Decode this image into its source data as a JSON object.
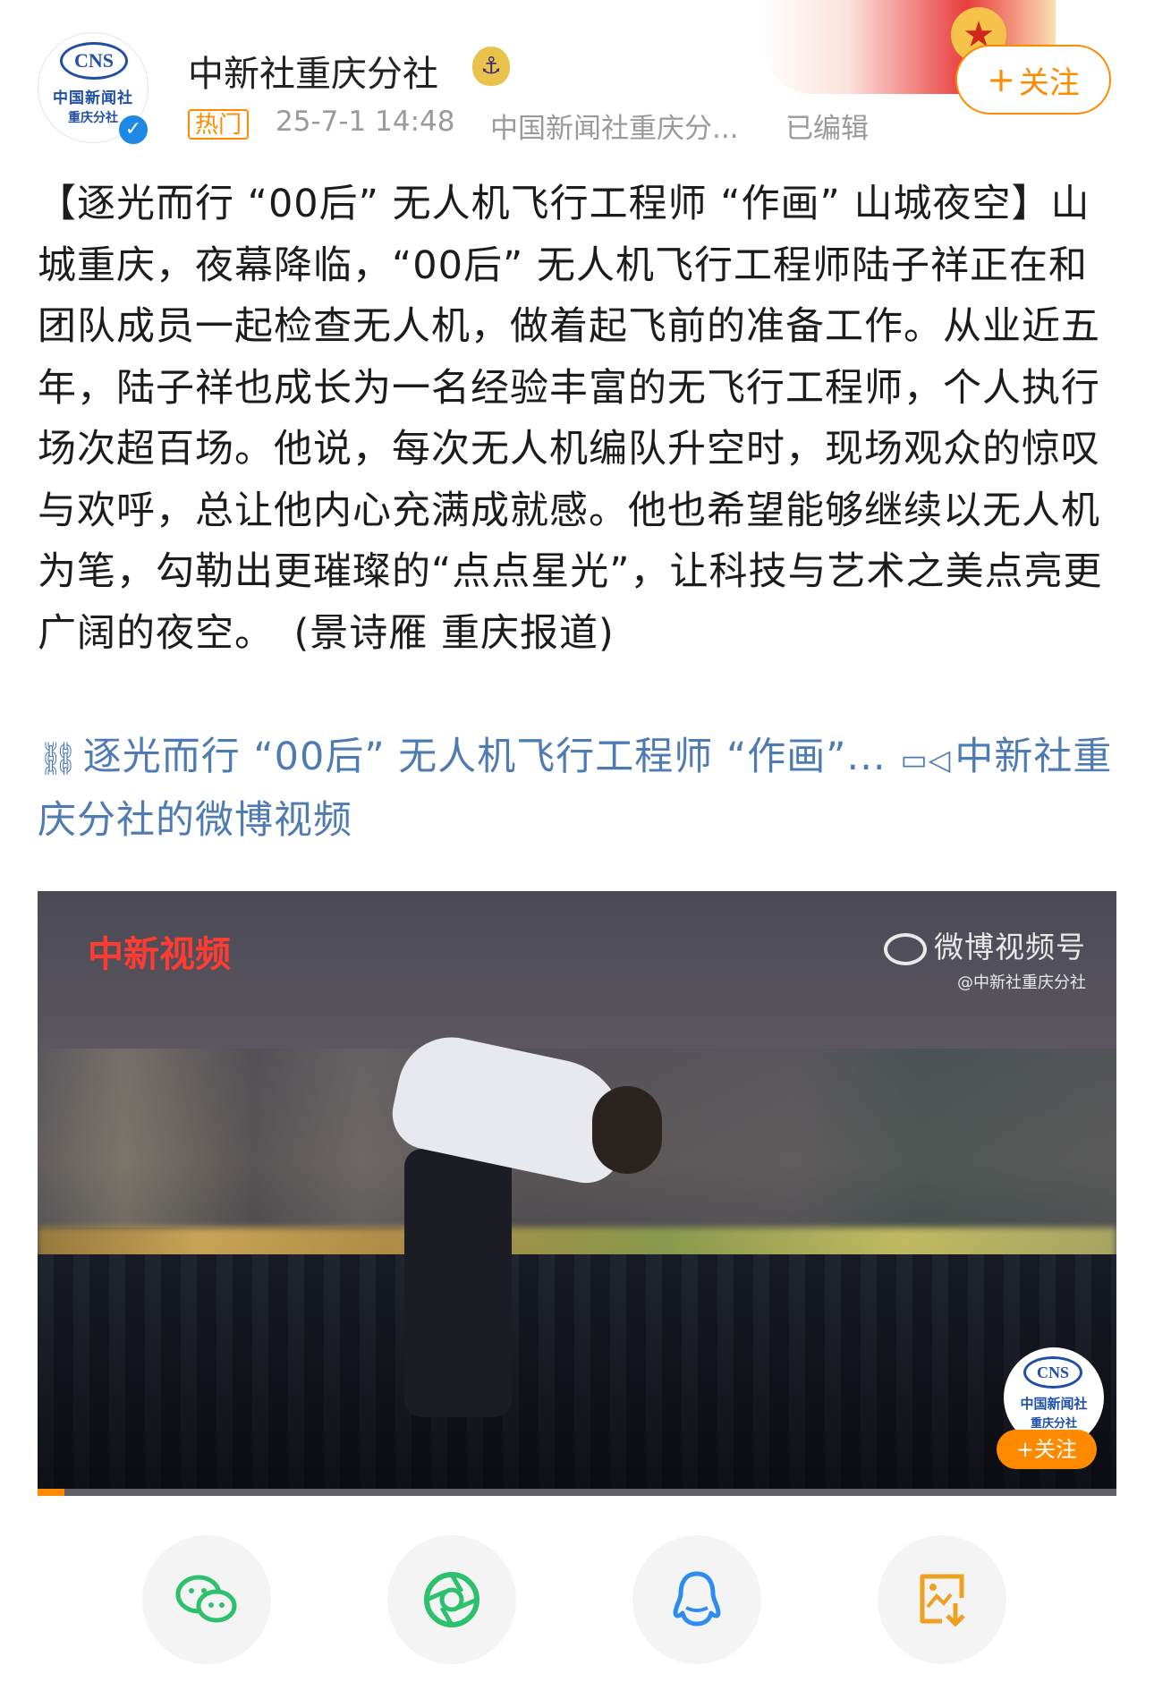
{
  "account": {
    "name": "中新社重庆分社",
    "avatar_text": {
      "ring": "CNS",
      "line1": "中国新闻社",
      "line2": "重庆分社"
    },
    "follow_label": "关注",
    "follow_plus": "+"
  },
  "meta": {
    "hot_tag": "热门",
    "time": "25-7-1 14:48",
    "source": "中国新闻社重庆分...",
    "edited": "已编辑"
  },
  "post": {
    "text": "【逐光而行 “00后” 无人机飞行工程师 “作画” 山城夜空】山城重庆，夜幕降临，“00后” 无人机飞行工程师陆子祥正在和团队成员一起检查无人机，做着起飞前的准备工作。从业近五年，陆子祥也成长为一名经验丰富的无飞行工程师，个人执行场次超百场。他说，每次无人机编队升空时，现场观众的惊叹与欢呼，总让他内心充满成就感。他也希望能够继续以无人机为笔，勾勒出更璀璨的“点点星光”，让科技与艺术之美点亮更广阔的夜空。　(景诗雁 重庆报道)",
    "link_text": "逐光而行 “00后” 无人机飞行工程师 “作画”...",
    "video_link_text": "中新社重庆分社的微博视频"
  },
  "video": {
    "watermark_left": "中新视频",
    "watermark_right_title": "微博视频号",
    "watermark_right_handle": "@中新社重庆分社",
    "mini_avatar": {
      "ring": "CNS",
      "line1": "中国新闻社",
      "line2": "重庆分社"
    },
    "mini_follow": "+关注",
    "progress": 0.025
  },
  "share_bar": {
    "items": [
      "wechat-icon",
      "moments-icon",
      "qq-icon",
      "save-image-icon"
    ]
  },
  "colors": {
    "accent_orange": "#ff8a00",
    "link_blue": "#4f7bb4",
    "meta_gray": "#9a9a9a",
    "wechat_green": "#2dc06d",
    "qq_blue": "#2e8cf0"
  }
}
